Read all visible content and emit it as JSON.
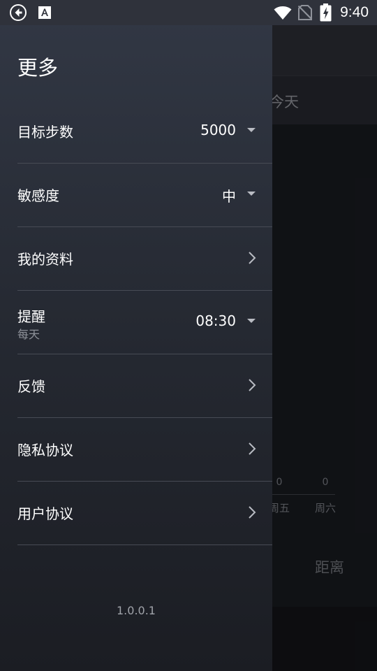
{
  "status_bar": {
    "time": "9:40"
  },
  "drawer": {
    "title": "更多",
    "items": [
      {
        "label": "目标步数",
        "value": "5000",
        "control": "dropdown"
      },
      {
        "label": "敏感度",
        "value": "中",
        "control": "dropdown"
      },
      {
        "label": "我的资料",
        "control": "chevron"
      },
      {
        "label": "提醒",
        "sublabel": "每天",
        "value": "08:30",
        "control": "dropdown"
      },
      {
        "label": "反馈",
        "control": "chevron"
      },
      {
        "label": "隐私协议",
        "control": "chevron"
      },
      {
        "label": "用户协议",
        "control": "chevron"
      }
    ],
    "version": "1.0.0.1"
  },
  "background": {
    "today_tab": "今天",
    "chart_values": [
      "0",
      "0"
    ],
    "chart_days": [
      "周五",
      "周六"
    ],
    "distance_label": "距离"
  },
  "colors": {
    "drawer_top": "#323845",
    "drawer_bottom": "#1b1d23",
    "divider": "#474b55",
    "secondary_text": "#8e929a"
  }
}
